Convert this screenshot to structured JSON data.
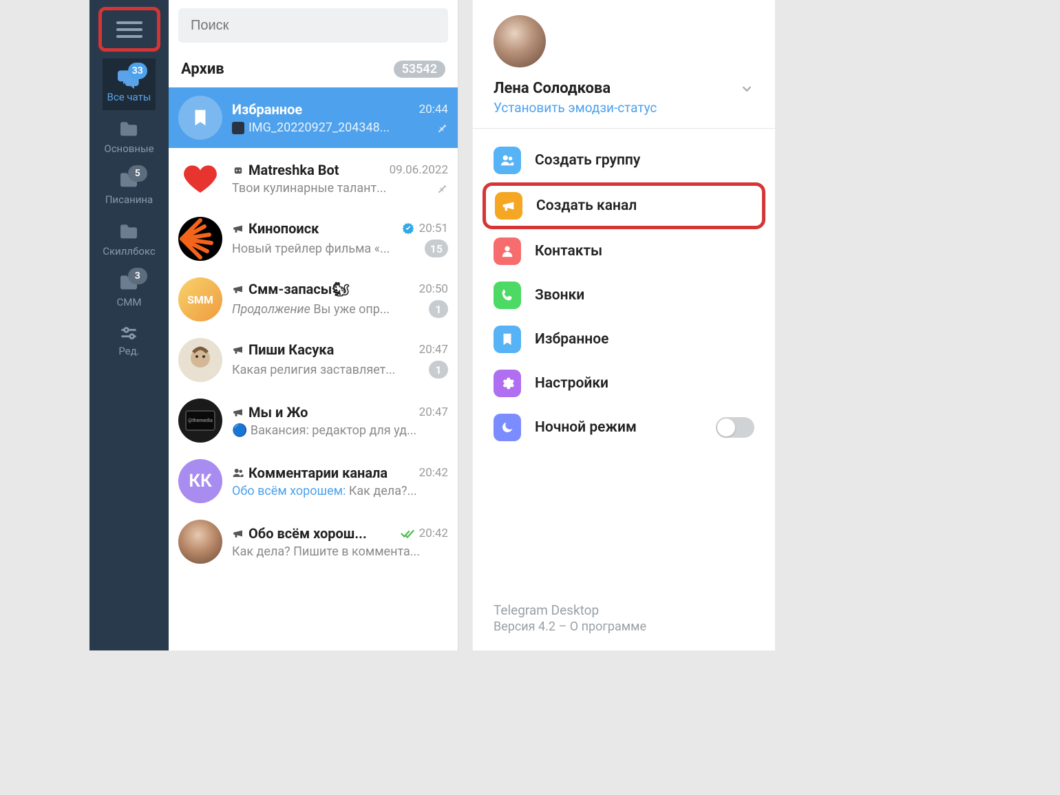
{
  "search": {
    "placeholder": "Поиск"
  },
  "archive": {
    "label": "Архив",
    "count": "53542"
  },
  "folders": [
    {
      "id": "all",
      "label": "Все чаты",
      "badge": "33",
      "active": true,
      "icon": "chats"
    },
    {
      "id": "main",
      "label": "Основные",
      "icon": "folder"
    },
    {
      "id": "writing",
      "label": "Писанина",
      "badge": "5",
      "badgeGray": true,
      "icon": "folder"
    },
    {
      "id": "skillbox",
      "label": "Скиллбокс",
      "icon": "folder"
    },
    {
      "id": "smm",
      "label": "СММ",
      "badge": "3",
      "badgeGray": true,
      "icon": "folder"
    },
    {
      "id": "edit",
      "label": "Ред.",
      "icon": "sliders"
    }
  ],
  "chats": [
    {
      "id": "saved",
      "name": "Избранное",
      "time": "20:44",
      "preview": "IMG_20220927_204348...",
      "pinned": true,
      "selected": true,
      "avatarType": "bookmark",
      "avatarBg": "#7ab8ef",
      "hasThumb": true
    },
    {
      "id": "matreshka",
      "name": "Matreshka Bot",
      "time": "09.06.2022",
      "preview": "Твои кулинарные талант...",
      "pinned": true,
      "avatarType": "heart",
      "iconType": "bot"
    },
    {
      "id": "kinopoisk",
      "name": "Кинопоиск",
      "time": "20:51",
      "preview": "Новый трейлер фильма «...",
      "unread": "15",
      "avatarType": "kino",
      "iconType": "channel",
      "verified": true
    },
    {
      "id": "smm",
      "name": "Смм-запасы🐿",
      "time": "20:50",
      "preview": "Вы уже опр...",
      "previewPrefix": "Продолжение ",
      "unread": "1",
      "avatarType": "smm",
      "iconType": "channel"
    },
    {
      "id": "kasuka",
      "name": "Пиши Касука",
      "time": "20:47",
      "preview": "Какая религия заставляет...",
      "unread": "1",
      "avatarType": "kasuka",
      "iconType": "channel"
    },
    {
      "id": "myijo",
      "name": "Мы и Жо",
      "time": "20:47",
      "preview": "🔵 Вакансия: редактор для уд...",
      "avatarType": "media",
      "iconType": "channel"
    },
    {
      "id": "comments",
      "name": "Комментарии канала",
      "time": "20:42",
      "preview": "Как дела?...",
      "previewSender": "Обо всём хорошем: ",
      "avatarType": "kk",
      "avatarBg": "#a98cf0",
      "avatarText": "КК",
      "iconType": "group"
    },
    {
      "id": "obovsem",
      "name": "Обо всём хорош...",
      "time": "20:42",
      "preview": "Как дела? Пишите в коммента...",
      "avatarType": "photo",
      "iconType": "channel",
      "sent": true
    }
  ],
  "profile": {
    "name": "Лена Солодкова",
    "status": "Установить эмодзи-статус"
  },
  "menu": [
    {
      "id": "group",
      "label": "Создать группу",
      "iconClass": "mi-group",
      "icon": "group"
    },
    {
      "id": "channel",
      "label": "Создать канал",
      "iconClass": "mi-channel",
      "icon": "megaphone",
      "highlighted": true
    },
    {
      "id": "contacts",
      "label": "Контакты",
      "iconClass": "mi-contacts",
      "icon": "person"
    },
    {
      "id": "calls",
      "label": "Звонки",
      "iconClass": "mi-calls",
      "icon": "phone"
    },
    {
      "id": "saved",
      "label": "Избранное",
      "iconClass": "mi-saved",
      "icon": "bookmark"
    },
    {
      "id": "settings",
      "label": "Настройки",
      "iconClass": "mi-settings",
      "icon": "gear"
    },
    {
      "id": "night",
      "label": "Ночной режим",
      "iconClass": "mi-night",
      "icon": "moon",
      "toggle": true
    }
  ],
  "footer": {
    "app": "Telegram Desktop",
    "version": "Версия 4.2 – О программе"
  }
}
